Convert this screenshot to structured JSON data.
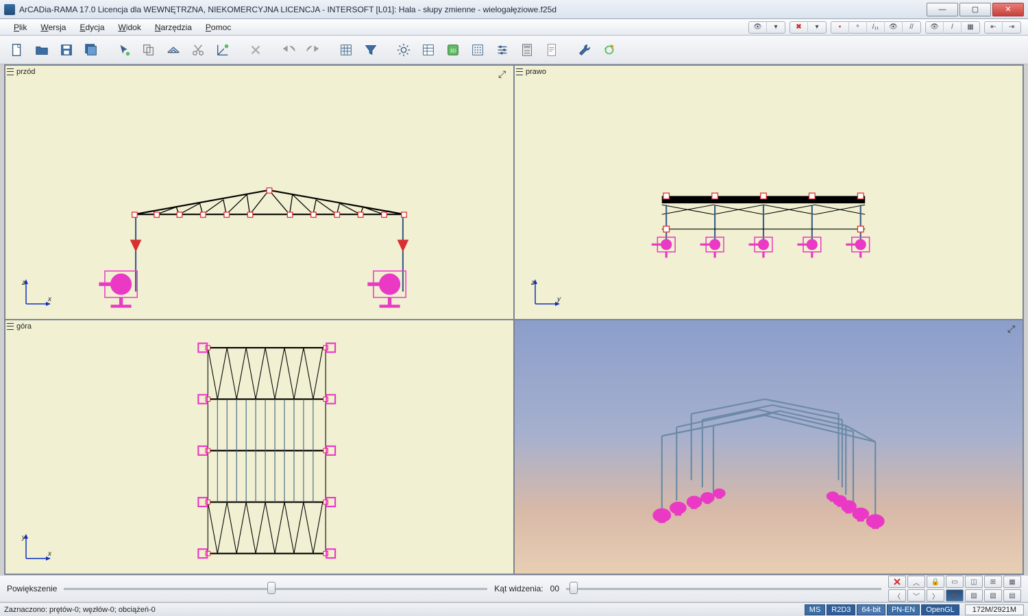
{
  "title": "ArCADia-RAMA 17.0 Licencja dla WEWNĘTRZNA, NIEKOMERCYJNA LICENCJA - INTERSOFT [L01]: Hala - słupy zmienne - wielogałęziowe.f25d",
  "menu": {
    "plik": "Plik",
    "wersja": "Wersja",
    "edycja": "Edycja",
    "widok": "Widok",
    "narzedzia": "Narzędzia",
    "pomoc": "Pomoc"
  },
  "views": {
    "front": "przód",
    "right": "prawo",
    "top": "góra",
    "perspective": ""
  },
  "bottom": {
    "zoom_label": "Powiększenie",
    "fov_label": "Kąt widzenia:",
    "fov_value": "00"
  },
  "status": {
    "selection": "Zaznaczono: prętów-0; węzłów-0; obciążeń-0",
    "ms": "MS",
    "r2d3": "R2D3",
    "bit": "64-bit",
    "pn": "PN-EN",
    "ogl": "OpenGL",
    "mem": "172M/2921M"
  }
}
